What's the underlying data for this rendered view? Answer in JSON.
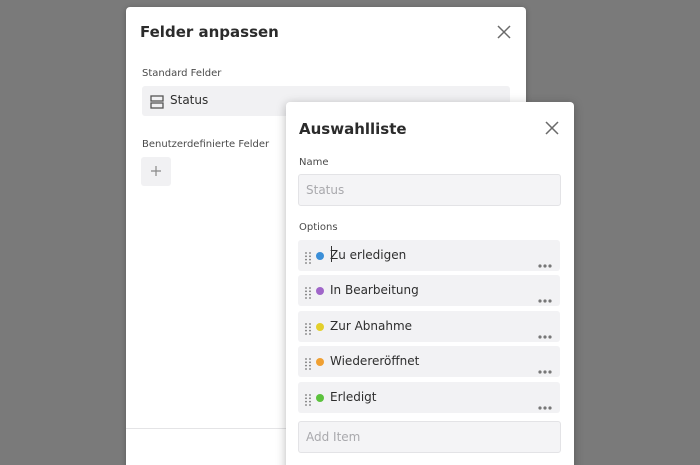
{
  "back_panel": {
    "title": "Felder anpassen",
    "standard_label": "Standard Felder",
    "standard_field": "Status",
    "custom_label": "Benutzerdefinierte Felder"
  },
  "front_panel": {
    "title": "Auswahlliste",
    "name_label": "Name",
    "name_placeholder": "Status",
    "options_label": "Options",
    "options": [
      {
        "label": "Zu erledigen",
        "color": "#3b8fd8"
      },
      {
        "label": "In Bearbeitung",
        "color": "#a066c9"
      },
      {
        "label": "Zur Abnahme",
        "color": "#e3cf2b"
      },
      {
        "label": "Wiedereröffnet",
        "color": "#f0a032"
      },
      {
        "label": "Erledigt",
        "color": "#5cc23d"
      }
    ],
    "add_item_placeholder": "Add Item"
  }
}
